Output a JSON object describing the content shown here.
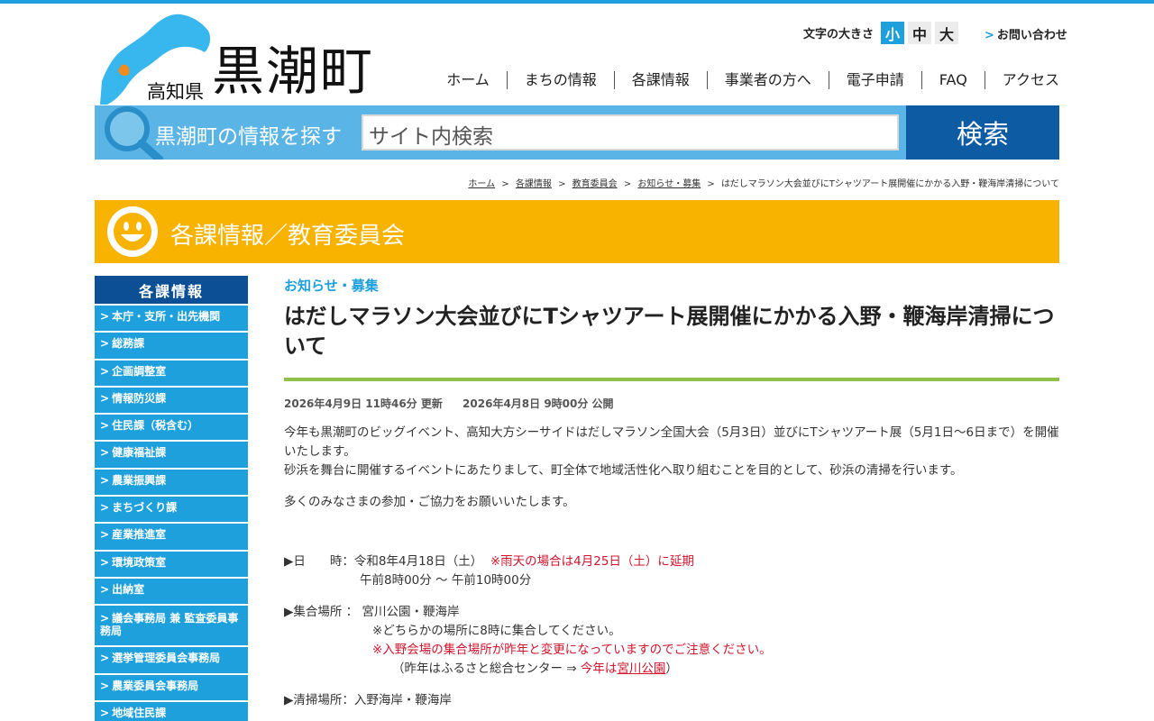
{
  "header": {
    "prefecture": "高知県",
    "town": "黒潮町",
    "font_size_label": "文字の大きさ",
    "font_sizes": [
      "小",
      "中",
      "大"
    ],
    "contact": "お問い合わせ",
    "nav": [
      "ホーム",
      "まちの情報",
      "各課情報",
      "事業者の方へ",
      "電子申請",
      "FAQ",
      "アクセス"
    ]
  },
  "search": {
    "title": "黒潮町の情報を探す",
    "placeholder": "サイト内検索",
    "button": "検索"
  },
  "breadcrumb": {
    "items": [
      "ホーム",
      "各課情報",
      "教育委員会",
      "お知らせ・募集"
    ],
    "current": "はだしマラソン大会並びにTシャツアート展開催にかかる入野・鞭海岸清掃について",
    "sep": ">"
  },
  "banner": {
    "title": "各課情報／教育委員会"
  },
  "sidebar": {
    "heading": "各課情報",
    "items": [
      "本庁・支所・出先機関",
      "総務課",
      "企画調整室",
      "情報防災課",
      "住民課（税含む）",
      "健康福祉課",
      "農業振興課",
      "まちづくり課",
      "産業推進室",
      "環境政策室",
      "出納室",
      "議会事務局 兼 監査委員事務局",
      "選挙管理委員会事務局",
      "農業委員会事務局",
      "地域住民課"
    ]
  },
  "article": {
    "category": "お知らせ・募集",
    "title": "はだしマラソン大会並びにTシャツアート展開催にかかる入野・鞭海岸清掃について",
    "updated": "2026年4月9日 11時46分 更新",
    "published": "2026年4月8日 9時00分 公開",
    "para1_line1": "今年も黒潮町のビッグイベント、高知大方シーサイドはだしマラソン全国大会（5月3日）並びにTシャツアート展（5月1日～6日まで）を開催いたします。",
    "para1_line2": "砂浜を舞台に開催するイベントにあたりまして、町全体で地域活性化へ取り組むことを目的として、砂浜の清掃を行います。",
    "para2": "多くのみなさまの参加・ご協力をお願いいたします。",
    "date_label": "▶日　　時：",
    "date_value": "令和8年4月18日（土）",
    "date_note": "※雨天の場合は4月25日（土）に延期",
    "time_value": "午前8時00分 ～ 午前10時00分",
    "place_label": "▶集合場所 ：",
    "place_value": "宮川公園・鞭海岸",
    "place_note1": "※どちらかの場所に8時に集合してください。",
    "place_note2": "※入野会場の集合場所が昨年と変更になっていますのでご注意ください。",
    "place_note3_pre": "（昨年はふるさと総合センター ⇒ ",
    "place_note3_red": "今年は",
    "place_note3_link": "宮川公園",
    "place_note3_post": "）",
    "clean_label": "▶清掃場所：",
    "clean_value": "入野海岸・鞭海岸"
  },
  "colors": {
    "accent": "#1ea0dc",
    "navy": "#0d5ba3",
    "banner": "#f8b301",
    "rule": "#8dc14a",
    "alert": "#d0142c"
  }
}
